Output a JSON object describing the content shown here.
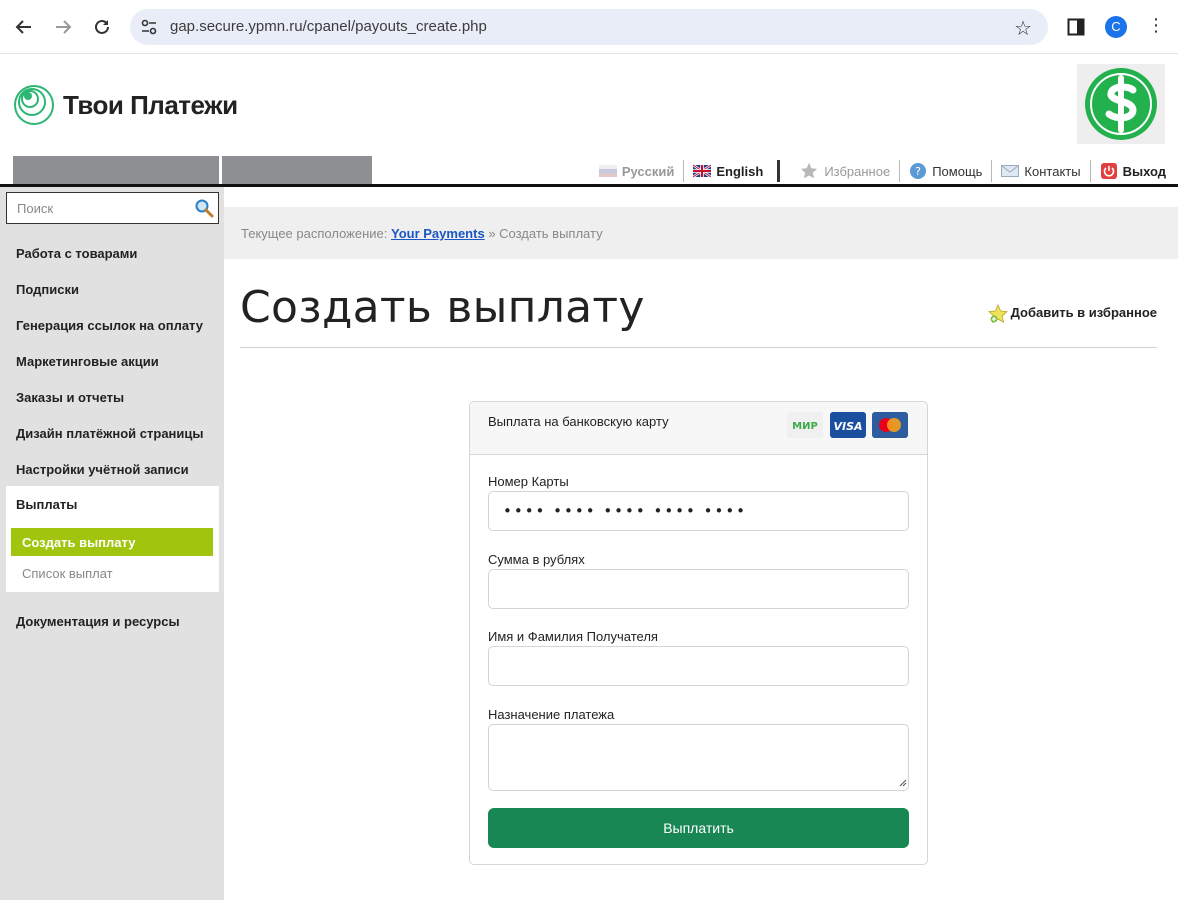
{
  "browser": {
    "url": "gap.secure.ypmn.ru/cpanel/payouts_create.php",
    "profile_initial": "C"
  },
  "site": {
    "logo_text": "Твои Платежи"
  },
  "topnav": {
    "russian": "Русский",
    "english": "English",
    "favorites": "Избранное",
    "help": "Помощь",
    "contacts": "Контакты",
    "logout": "Выход"
  },
  "sidebar": {
    "search_placeholder": "Поиск",
    "items": [
      "Работа с товарами",
      "Подписки",
      "Генерация ссылок на оплату",
      "Маркетинговые акции",
      "Заказы и отчеты",
      "Дизайн платёжной страницы",
      "Настройки учётной записи"
    ],
    "payouts": {
      "title": "Выплаты",
      "active": "Создать выплату",
      "list": "Список выплат"
    },
    "docs": "Документация и ресурсы"
  },
  "breadcrumb": {
    "prefix": "Текущее расположение:",
    "link": "Your Payments",
    "current": "» Создать выплату"
  },
  "page": {
    "title": "Создать выплату",
    "add_favorite": "Добавить в избранное"
  },
  "form": {
    "header": "Выплата на банковскую карту",
    "card_logos": [
      "МИР",
      "VISA",
      "Mastercard"
    ],
    "card_number_label": "Номер Карты",
    "card_number_placeholder": "•••• •••• •••• •••• ••••",
    "amount_label": "Сумма в рублях",
    "amount_value": "",
    "recipient_label": "Имя и Фамилия Получателя",
    "recipient_value": "",
    "purpose_label": "Назначение платежа",
    "purpose_value": "",
    "submit": "Выплатить"
  },
  "colors": {
    "accent_green": "#a1c40f",
    "submit_green": "#198754",
    "link_blue": "#1a56c4"
  }
}
